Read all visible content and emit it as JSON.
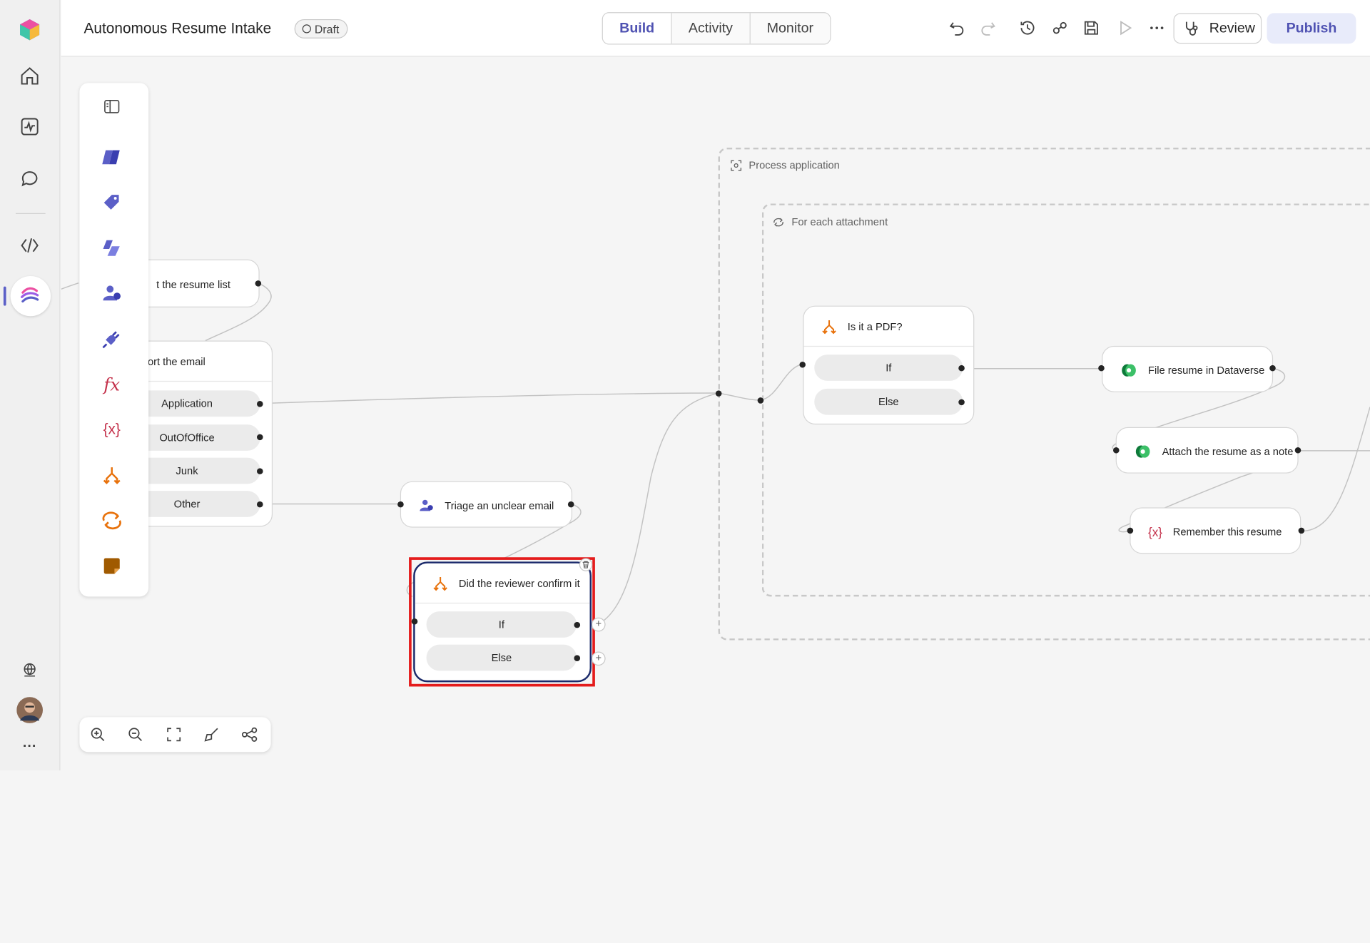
{
  "header": {
    "title": "Autonomous Resume Intake",
    "status_badge": "Draft",
    "tabs": [
      {
        "label": "Build",
        "active": true
      },
      {
        "label": "Activity",
        "active": false
      },
      {
        "label": "Monitor",
        "active": false
      }
    ],
    "review_label": "Review",
    "publish_label": "Publish"
  },
  "rail": {
    "items": [
      "app-logo-icon",
      "home-icon",
      "activity-icon",
      "chat-icon",
      "code-icon",
      "flows-icon"
    ],
    "bottom": [
      "globe-icon",
      "user-avatar",
      "more-icon"
    ],
    "more_glyph": "···"
  },
  "palette": {
    "items": [
      "collapse-panel-icon",
      "code-tool-icon",
      "tag-icon",
      "copilot-icon",
      "human-review-icon",
      "connector-icon",
      "expression-icon",
      "variable-icon",
      "condition-icon",
      "loop-icon",
      "sticky-note-icon"
    ],
    "fx_glyph": "fx",
    "var_glyph": "{x}"
  },
  "canvas": {
    "groups": {
      "process_application": "Process application",
      "for_each": "For each attachment"
    },
    "nodes": {
      "resume_list": "t the resume list",
      "sort_email": "ort the email",
      "sort_branches": [
        "Application",
        "OutOfOffice",
        "Junk",
        "Other"
      ],
      "triage": "Triage an unclear email",
      "reviewer_confirm": "Did the reviewer confirm it",
      "reviewer_branches": [
        "If",
        "Else"
      ],
      "is_pdf": "Is it a PDF?",
      "pdf_branches": [
        "If",
        "Else"
      ],
      "file_resume": "File resume in Dataverse",
      "attach_note": "Attach the resume as a note",
      "remember": "Remember this resume"
    },
    "plus_glyph": "+",
    "colors": {
      "accent": "#5b5fc7",
      "condition": "#e8720c",
      "variable": "#c4314b",
      "dataverse": "#0e7a3a",
      "selection": "#e41c1c"
    }
  },
  "zoom_toolbar": [
    "zoom-in-icon",
    "zoom-out-icon",
    "fit-view-icon",
    "tidy-icon",
    "map-icon"
  ]
}
